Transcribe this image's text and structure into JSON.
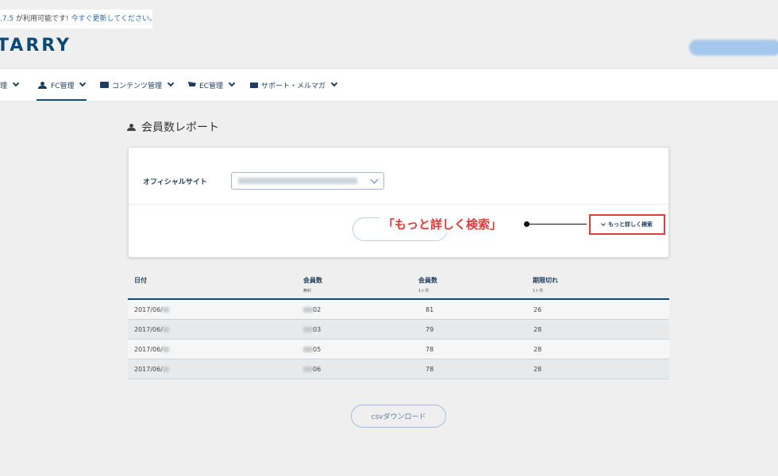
{
  "notice": {
    "version": ".7.5",
    "text": " が利用可能です! ",
    "link": "今すぐ更新してください。"
  },
  "brand": {
    "logo_text": "TARRY"
  },
  "nav": {
    "items": [
      {
        "label": "理",
        "icon": "none"
      },
      {
        "label": "FC管理",
        "icon": "users-icon"
      },
      {
        "label": "コンテンツ管理",
        "icon": "folder-icon"
      },
      {
        "label": "EC管理",
        "icon": "cart-icon"
      },
      {
        "label": "サポート・メルマガ",
        "icon": "mail-icon"
      }
    ]
  },
  "page": {
    "title": "会員数レポート"
  },
  "filter": {
    "site_label": "オフィシャルサイト",
    "detail_link": "もっと詳しく検索"
  },
  "annotation": {
    "callout": "「もっと詳しく検索」",
    "color": "#e53935"
  },
  "table": {
    "headers": [
      {
        "label": "日付",
        "sub": ""
      },
      {
        "label": "会員数",
        "sub": "無料"
      },
      {
        "label": "会員数",
        "sub": "1ヶ月"
      },
      {
        "label": "期限切れ",
        "sub": "1ヶ月"
      }
    ],
    "rows": [
      {
        "date": "2017/06/",
        "free": "02",
        "month": "81",
        "expired": "26"
      },
      {
        "date": "2017/06/",
        "free": "03",
        "month": "79",
        "expired": "28"
      },
      {
        "date": "2017/06/",
        "free": "05",
        "month": "78",
        "expired": "28"
      },
      {
        "date": "2017/06/",
        "free": "06",
        "month": "78",
        "expired": "28"
      }
    ]
  },
  "actions": {
    "csv": "csvダウンロード"
  },
  "colors": {
    "brand": "#0c4a73",
    "nav_text": "#1f3d5c",
    "accent_red": "#e53935"
  }
}
